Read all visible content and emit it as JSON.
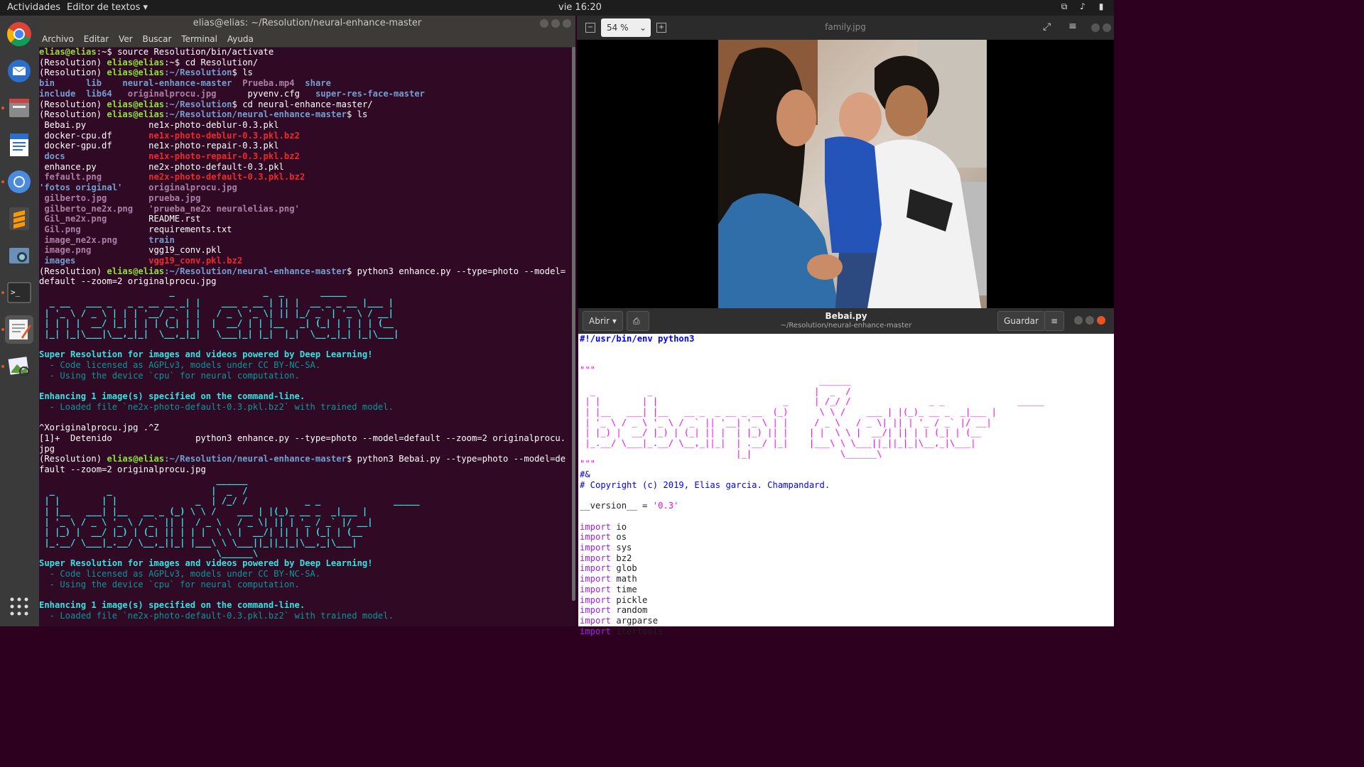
{
  "topbar": {
    "activities": "Actividades",
    "app": "Editor de textos ▾",
    "clock": "vie 16:20"
  },
  "dock": {
    "items": [
      "chrome-icon",
      "thunderbird-icon",
      "files-icon",
      "writer-icon",
      "chromium-icon",
      "sublime-icon",
      "screenshot-icon",
      "terminal-icon",
      "text-editor-icon",
      "image-viewer-icon",
      "show-apps-icon"
    ]
  },
  "terminal": {
    "title": "elias@elias: ~/Resolution/neural-enhance-master",
    "menu": [
      "Archivo",
      "Editar",
      "Ver",
      "Buscar",
      "Terminal",
      "Ayuda"
    ],
    "prompt_user": "elias@elias",
    "venv": "(Resolution)",
    "lines": {
      "l1cmd": "$ source Resolution/bin/activate",
      "l2cmd": "$ cd Resolution/",
      "l3path": ":~/Resolution",
      "l3cmd": "$ ls",
      "ls1": [
        "bin",
        "lib",
        "neural-enhance-master",
        "Prueba.mp4",
        "share"
      ],
      "ls2": [
        "include",
        "lib64",
        "originalprocu.jpg",
        "pyvenv.cfg",
        "super-res-face-master"
      ],
      "l4cmd": "$ cd neural-enhance-master/",
      "path2": ":~/Resolution/neural-enhance-master",
      "enhance_cmd1": "$ python3 enhance.py --type=photo --model=",
      "enhance_cmd1b": "default --zoom=2 originalprocu.jpg",
      "super": "Super Resolution for images and videos powered by Deep Learning!",
      "lic": "  - Code licensed as AGPLv3, models under CC BY-NC-SA.",
      "dev": "  - Using the device `cpu` for neural computation.",
      "enh": "Enhancing 1 image(s) specified on the command-line.",
      "loaded": "  - Loaded file `ne2x-photo-default-0.3.pkl.bz2` with trained model.",
      "ctrlz": "^Xoriginalprocu.jpg .^Z",
      "stopped": "[1]+  Detenido                python3 enhance.py --type=photo --model=default --zoom=2 originalprocu.",
      "stopped2": "jpg",
      "bebai_cmd": "$ python3 Bebai.py --type=photo --model=de",
      "bebai_cmd2": "fault --zoom=2 originalprocu.jpg"
    },
    "files": [
      [
        "Bebai.py",
        "ne1x-photo-deblur-0.3.pkl"
      ],
      [
        "docker-cpu.df",
        "ne1x-photo-deblur-0.3.pkl.bz2"
      ],
      [
        "docker-gpu.df",
        "ne1x-photo-repair-0.3.pkl"
      ],
      [
        "docs",
        "ne1x-photo-repair-0.3.pkl.bz2"
      ],
      [
        "enhance.py",
        "ne2x-photo-default-0.3.pkl"
      ],
      [
        "fefault.png",
        "ne2x-photo-default-0.3.pkl.bz2"
      ],
      [
        "'fotos original'",
        "originalprocu.jpg"
      ],
      [
        "gilberto.jpg",
        "prueba.jpg"
      ],
      [
        "gilberto_ne2x.png",
        "'prueba_ne2x neuralelias.png'"
      ],
      [
        "Gil_ne2x.png",
        "README.rst"
      ],
      [
        "Gil.png",
        "requirements.txt"
      ],
      [
        "image_ne2x.png",
        "train"
      ],
      [
        "image.png",
        "vgg19_conv.pkl"
      ],
      [
        "images",
        "vgg19_conv.pkl.bz2"
      ]
    ]
  },
  "viewer": {
    "zoom": "54 %",
    "filename": "family.jpg"
  },
  "editor": {
    "open": "Abrir ▾",
    "save": "Guardar",
    "title": "Bebai.py",
    "path": "~/Resolution/neural-enhance-master",
    "shebang": "#!/usr/bin/env python3",
    "docq": "\"\"\"",
    "hash": "#&",
    "copyright": "# Copyright (c) 2019, Elias garcia. Champandard.",
    "version_name": "__version__ = ",
    "version_val": "'0.3'",
    "imports": [
      "io",
      "os",
      "sys",
      "bz2",
      "glob",
      "math",
      "time",
      "pickle",
      "random",
      "argparse",
      "itertools"
    ],
    "import_kw": "import"
  },
  "colors": {
    "terminal_bg": "#300a24",
    "prompt_green": "#8ae234",
    "path_blue": "#729fcf",
    "archive_red": "#ef2929",
    "banner_cyan": "#34e2e2"
  }
}
